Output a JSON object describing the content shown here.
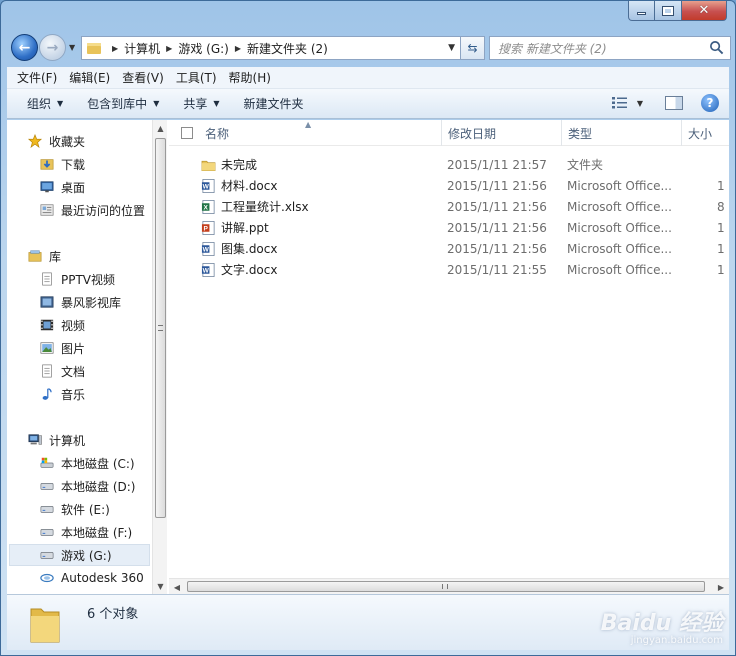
{
  "window": {
    "caption": {
      "minimize": "",
      "maximize": "",
      "close": "✕"
    }
  },
  "address": {
    "breadcrumbs": [
      "计算机",
      "游戏 (G:)",
      "新建文件夹 (2)"
    ],
    "search_placeholder": "搜索 新建文件夹 (2)"
  },
  "menu": [
    "文件(F)",
    "编辑(E)",
    "查看(V)",
    "工具(T)",
    "帮助(H)"
  ],
  "toolbar": {
    "organize": "组织",
    "include_in_library": "包含到库中",
    "share": "共享",
    "new_folder": "新建文件夹",
    "help": "?"
  },
  "sidebar": {
    "favorites_header": "收藏夹",
    "favorites": [
      "下载",
      "桌面",
      "最近访问的位置"
    ],
    "libraries_header": "库",
    "libraries": [
      "PPTV视频",
      "暴风影视库",
      "视频",
      "图片",
      "文档",
      "音乐"
    ],
    "computer_header": "计算机",
    "drives": [
      "本地磁盘 (C:)",
      "本地磁盘 (D:)",
      "软件 (E:)",
      "本地磁盘 (F:)",
      "游戏 (G:)",
      "Autodesk 360"
    ],
    "selected": "游戏 (G:)"
  },
  "columns": {
    "name": "名称",
    "date": "修改日期",
    "type": "类型",
    "size": "大小"
  },
  "files": [
    {
      "name": "未完成",
      "date": "2015/1/11 21:57",
      "type": "文件夹",
      "size": "",
      "icon": "folder-icon"
    },
    {
      "name": "材料.docx",
      "date": "2015/1/11 21:56",
      "type": "Microsoft Office...",
      "size": "1",
      "icon": "word-icon"
    },
    {
      "name": "工程量统计.xlsx",
      "date": "2015/1/11 21:56",
      "type": "Microsoft Office...",
      "size": "8",
      "icon": "excel-icon"
    },
    {
      "name": "讲解.ppt",
      "date": "2015/1/11 21:56",
      "type": "Microsoft Office...",
      "size": "1",
      "icon": "powerpoint-icon"
    },
    {
      "name": "图集.docx",
      "date": "2015/1/11 21:56",
      "type": "Microsoft Office...",
      "size": "1",
      "icon": "word-icon"
    },
    {
      "name": "文字.docx",
      "date": "2015/1/11 21:55",
      "type": "Microsoft Office...",
      "size": "1",
      "icon": "word-icon"
    }
  ],
  "details": {
    "count_text": "6 个对象"
  },
  "watermark": {
    "brand": "Baidu 经验",
    "url": "jingyan.baidu.com"
  }
}
